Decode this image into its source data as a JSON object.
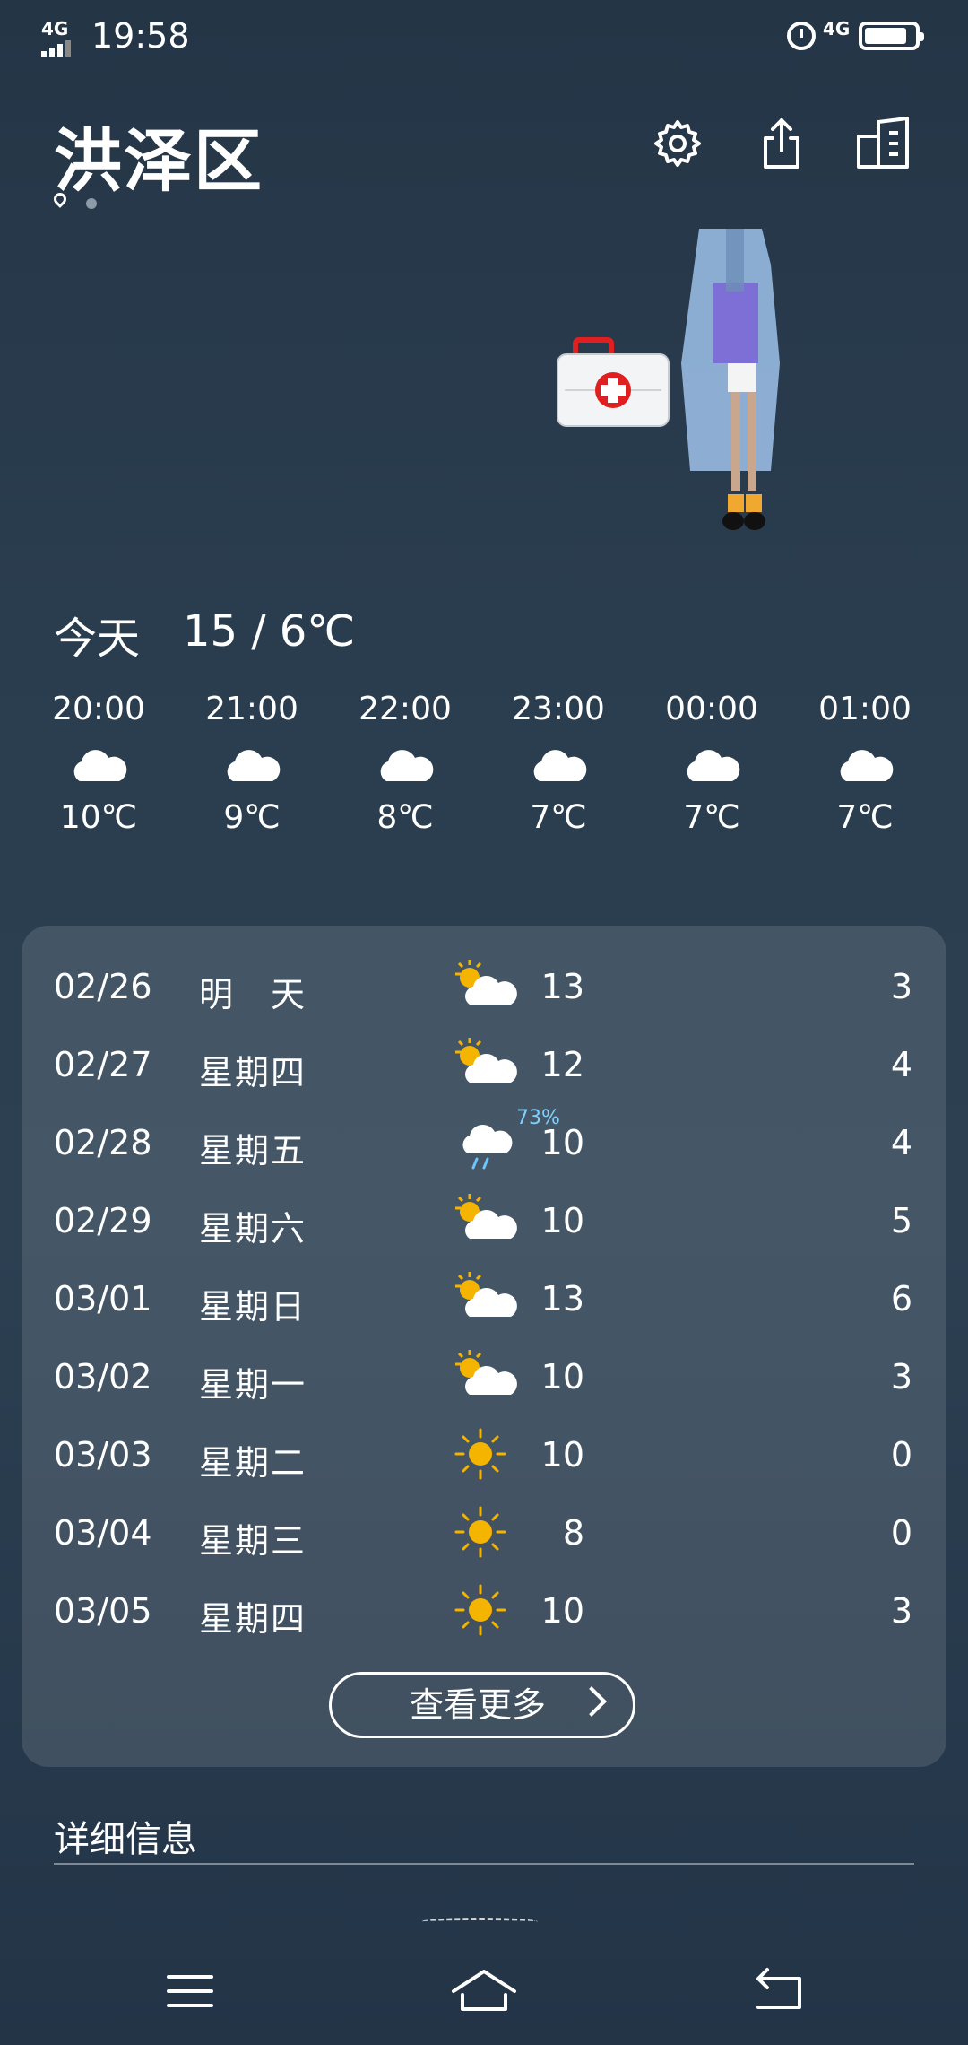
{
  "status_bar": {
    "network": "4G",
    "time": "19:58",
    "network_right": "4G"
  },
  "header": {
    "city": "洪泽区"
  },
  "today": {
    "label": "今天",
    "temp_range": "15 / 6℃"
  },
  "hourly": [
    {
      "time": "20:00",
      "icon": "cloud-icon",
      "temp": "10℃"
    },
    {
      "time": "21:00",
      "icon": "cloud-icon",
      "temp": "9℃"
    },
    {
      "time": "22:00",
      "icon": "cloud-icon",
      "temp": "8℃"
    },
    {
      "time": "23:00",
      "icon": "cloud-icon",
      "temp": "7℃"
    },
    {
      "time": "00:00",
      "icon": "cloud-icon",
      "temp": "7℃"
    },
    {
      "time": "01:00",
      "icon": "cloud-icon",
      "temp": "7℃"
    }
  ],
  "forecast": [
    {
      "date": "02/26",
      "weekday": "明　天",
      "icon": "partly-cloudy-icon",
      "pct": "",
      "high": "13",
      "low": "3"
    },
    {
      "date": "02/27",
      "weekday": "星期四",
      "icon": "partly-cloudy-icon",
      "pct": "",
      "high": "12",
      "low": "4"
    },
    {
      "date": "02/28",
      "weekday": "星期五",
      "icon": "rain-icon",
      "pct": "73%",
      "high": "10",
      "low": "4"
    },
    {
      "date": "02/29",
      "weekday": "星期六",
      "icon": "partly-cloudy-icon",
      "pct": "",
      "high": "10",
      "low": "5"
    },
    {
      "date": "03/01",
      "weekday": "星期日",
      "icon": "partly-cloudy-icon",
      "pct": "",
      "high": "13",
      "low": "6"
    },
    {
      "date": "03/02",
      "weekday": "星期一",
      "icon": "partly-cloudy-icon",
      "pct": "",
      "high": "10",
      "low": "3"
    },
    {
      "date": "03/03",
      "weekday": "星期二",
      "icon": "sun-icon",
      "pct": "",
      "high": "10",
      "low": "0"
    },
    {
      "date": "03/04",
      "weekday": "星期三",
      "icon": "sun-icon",
      "pct": "",
      "high": "8",
      "low": "0"
    },
    {
      "date": "03/05",
      "weekday": "星期四",
      "icon": "sun-icon",
      "pct": "",
      "high": "10",
      "low": "3"
    }
  ],
  "more_button": {
    "label": "查看更多"
  },
  "details": {
    "title": "详细信息"
  },
  "colors": {
    "sun": "#f5b400",
    "cloud": "#ffffff",
    "rain": "#6ec6ff",
    "background": "#2a3d4f"
  }
}
